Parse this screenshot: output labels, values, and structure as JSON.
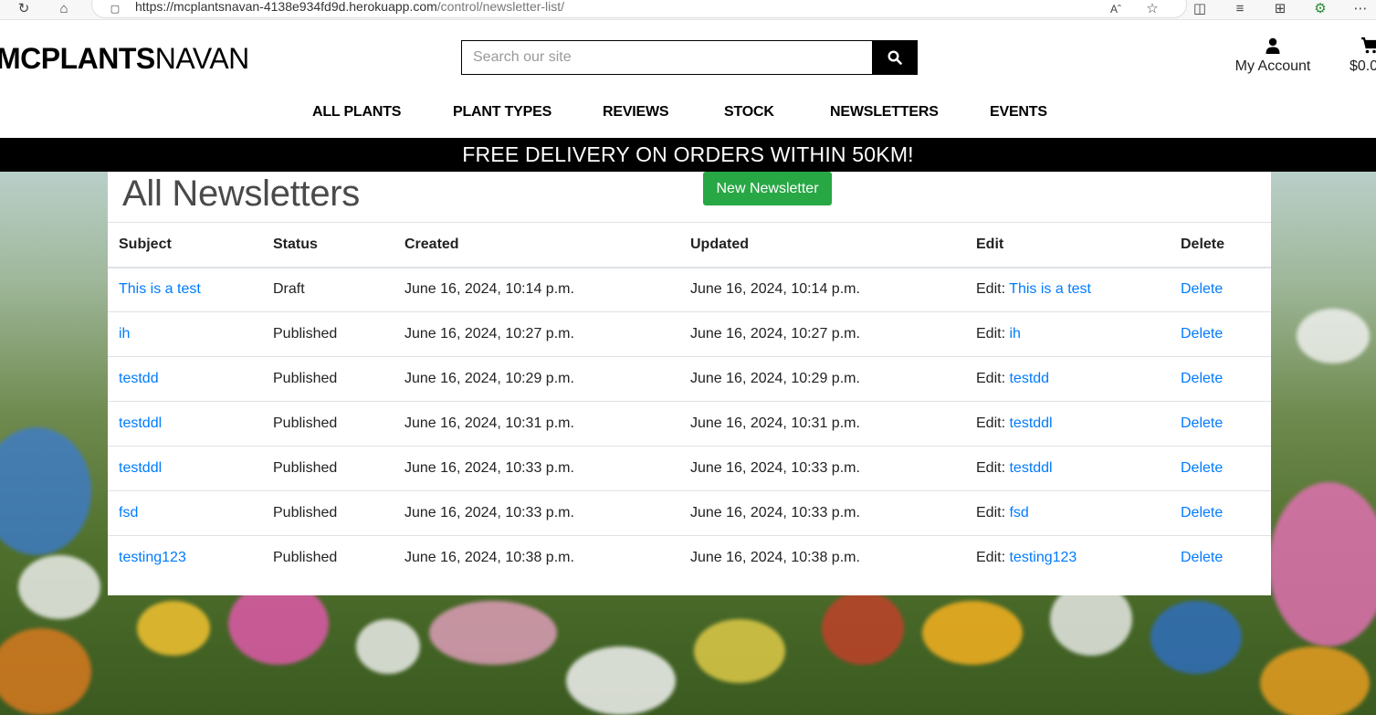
{
  "browser": {
    "url_host": "https://mcplantsnavan-4138e934fd9d.herokuapp.com",
    "url_path": "/control/newsletter-list/"
  },
  "header": {
    "logo_bold": "MCPLANTS",
    "logo_light": "NAVAN",
    "search_placeholder": "Search our site",
    "account_label": "My Account",
    "cart_label": "$0.0"
  },
  "nav": {
    "items": [
      {
        "label": "ALL PLANTS"
      },
      {
        "label": "PLANT TYPES"
      },
      {
        "label": "REVIEWS"
      },
      {
        "label": "STOCK"
      },
      {
        "label": "NEWSLETTERS"
      },
      {
        "label": "EVENTS"
      }
    ]
  },
  "banner": {
    "text": "FREE DELIVERY ON ORDERS WITHIN 50KM!"
  },
  "main": {
    "title": "All Newsletters",
    "new_button": "New Newsletter",
    "columns": [
      "Subject",
      "Status",
      "Created",
      "Updated",
      "Edit",
      "Delete"
    ],
    "edit_prefix": "Edit:",
    "delete_label": "Delete",
    "rows": [
      {
        "subject": "This is a test",
        "status": "Draft",
        "created": "June 16, 2024, 10:14 p.m.",
        "updated": "June 16, 2024, 10:14 p.m."
      },
      {
        "subject": "ih",
        "status": "Published",
        "created": "June 16, 2024, 10:27 p.m.",
        "updated": "June 16, 2024, 10:27 p.m."
      },
      {
        "subject": "testdd",
        "status": "Published",
        "created": "June 16, 2024, 10:29 p.m.",
        "updated": "June 16, 2024, 10:29 p.m."
      },
      {
        "subject": "testddl",
        "status": "Published",
        "created": "June 16, 2024, 10:31 p.m.",
        "updated": "June 16, 2024, 10:31 p.m."
      },
      {
        "subject": "testddl",
        "status": "Published",
        "created": "June 16, 2024, 10:33 p.m.",
        "updated": "June 16, 2024, 10:33 p.m."
      },
      {
        "subject": "fsd",
        "status": "Published",
        "created": "June 16, 2024, 10:33 p.m.",
        "updated": "June 16, 2024, 10:33 p.m."
      },
      {
        "subject": "testing123",
        "status": "Published",
        "created": "June 16, 2024, 10:38 p.m.",
        "updated": "June 16, 2024, 10:38 p.m."
      }
    ]
  },
  "colors": {
    "link": "#007bff",
    "new_button_bg": "#28a745",
    "banner_bg": "#000000"
  }
}
